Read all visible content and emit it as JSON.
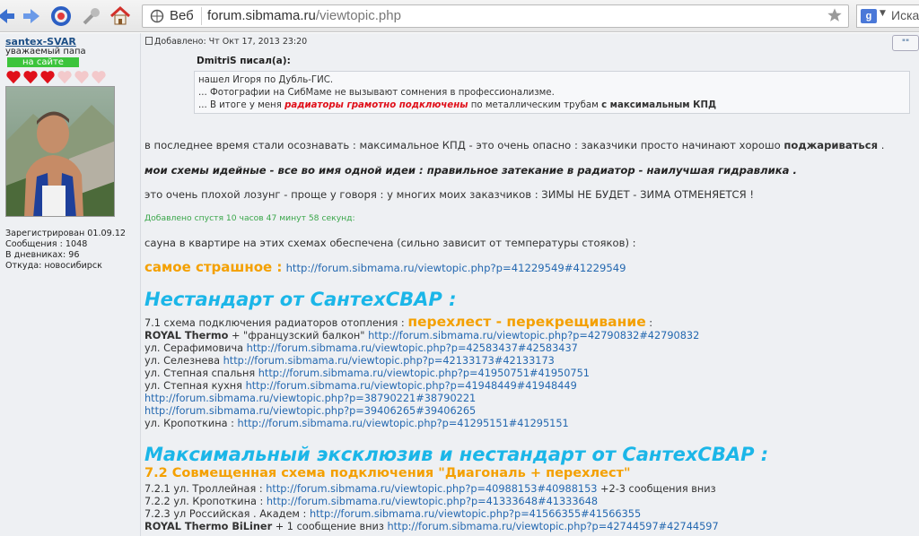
{
  "browser": {
    "web_label": "Веб",
    "url_host": "forum.sibmama.ru",
    "url_path": "/viewtopic.php",
    "search_placeholder": "Иска"
  },
  "author": {
    "name": "santex-SVAR",
    "rank": "уважаемый папа",
    "status": "на сайте",
    "hearts_filled": 3,
    "hearts_total": 6,
    "registered": "Зарегистрирован 01.09.12",
    "messages": "Сообщения : 1048",
    "diaries": "В дневниках: 96",
    "from": "Откуда: новосибирск"
  },
  "post": {
    "header": "Добавлено: Чт Окт 17, 2013 23:20",
    "quote_button": "\"\"",
    "quote": {
      "author": "DmitriS писал(а):",
      "line1": "нашел Игоря по Дубль-ГИС.",
      "line2": "... Фотографии на СибМаме не вызывают сомнения в профессионализме.",
      "line3_pre": "... В итоге у меня ",
      "line3_red": "радиаторы грамотно подключены",
      "line3_mid": " по металлическим трубам ",
      "line3_bold": "с максимальным КПД"
    },
    "p1_pre": "в последнее время стали осознавать : максимальное КПД - это очень опасно : заказчики просто начинают хорошо ",
    "p1_bold": "поджариваться",
    "p1_post": " .",
    "p2": "мои схемы идейные - все во имя одной идеи : правильное затекание в радиатор - наилучшая гидравлика .",
    "p3": "это очень плохой лозунг - проще у говоря : у многих моих заказчиков : ЗИМЫ НЕ БУДЕТ - ЗИМА ОТМЕНЯЕТСЯ !",
    "added_later": "Добавлено спустя 10 часов 47 минут 58 секунд:",
    "p4": "сауна в квартире на этих схемах обеспечена (сильно зависит от температуры стояков) :",
    "scary_label": "самое страшное :",
    "scary_link": "http://forum.sibmama.ru/viewtopic.php?p=41229549#41229549",
    "heading1": "Нестандарт от СантехСВАР :",
    "s71_pre": "7.1 схема подключения радиаторов отопления : ",
    "s71_orange": "перехлест - перекрещивание",
    "s71_post": " :",
    "royal1_bold": "ROYAL Thermo",
    "royal1_text": " + \"французский балкон\" ",
    "royal1_link": "http://forum.sibmama.ru/viewtopic.php?p=42790832#42790832",
    "ser_text": "ул. Серафимовича ",
    "ser_link": "http://forum.sibmama.ru/viewtopic.php?p=42583437#42583437",
    "sel_text": "ул. Селезнева ",
    "sel_link": "http://forum.sibmama.ru/viewtopic.php?p=42133173#42133173",
    "st1_text": "ул. Степная спальня ",
    "st1_link": "http://forum.sibmama.ru/viewtopic.php?p=41950751#41950751",
    "st2_text": "ул. Степная кухня ",
    "st2_link": "http://forum.sibmama.ru/viewtopic.php?p=41948449#41948449",
    "link_a": "http://forum.sibmama.ru/viewtopic.php?p=38790221#38790221",
    "link_b": "http://forum.sibmama.ru/viewtopic.php?p=39406265#39406265",
    "kr_text": "ул. Кропоткина : ",
    "kr_link": "http://forum.sibmama.ru/viewtopic.php?p=41295151#41295151",
    "heading2": "Максимальный эксклюзив и нестандарт от СантехСВАР :",
    "heading3": "7.2 Совмещенная схема подключения \"Диагональ + перехлест\"",
    "s721_text": "7.2.1 ул. Троллейная : ",
    "s721_link": "http://forum.sibmama.ru/viewtopic.php?p=40988153#40988153",
    "s721_post": " +2-3 сообщения вниз",
    "s722_text": "7.2.2 ул. Кропоткина : ",
    "s722_link": "http://forum.sibmama.ru/viewtopic.php?p=41333648#41333648",
    "s723_text": "7.2.3 ул Российская . Академ : ",
    "s723_link": "http://forum.sibmama.ru/viewtopic.php?p=41566355#41566355",
    "royal2_bold": "ROYAL Thermo BiLiner",
    "royal2_text": " + 1 сообщение вниз ",
    "royal2_link": "http://forum.sibmama.ru/viewtopic.php?p=42744597#42744597"
  },
  "colors": {
    "link": "#2468b0",
    "orange": "#f4a000",
    "cyan": "#1bb6e8",
    "red": "#e0101a",
    "green": "#3aa64a"
  }
}
